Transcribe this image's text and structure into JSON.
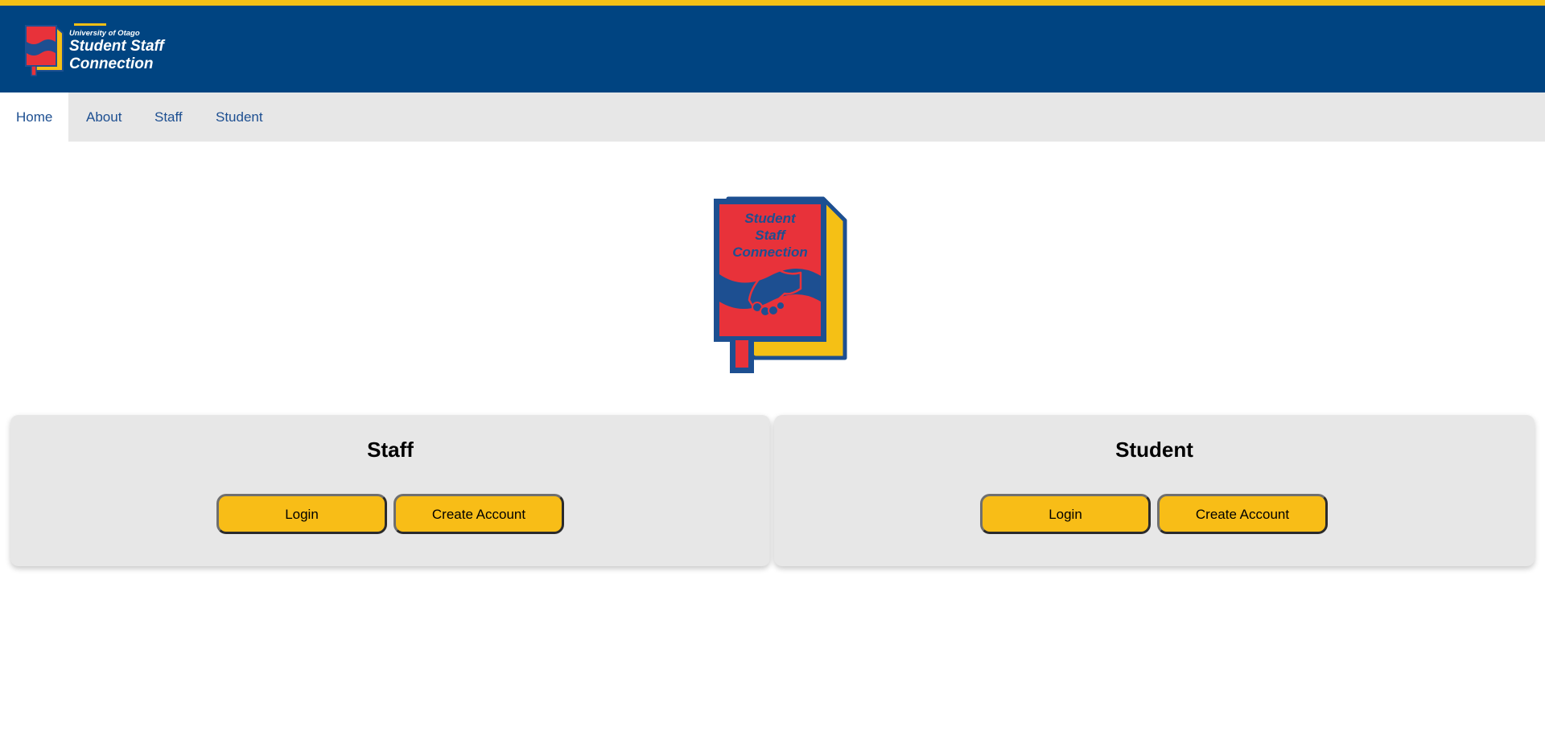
{
  "header": {
    "university": "University of Otago",
    "brand_line1": "Student Staff",
    "brand_line2": "Connection"
  },
  "nav": {
    "items": [
      {
        "label": "Home",
        "active": true
      },
      {
        "label": "About",
        "active": false
      },
      {
        "label": "Staff",
        "active": false
      },
      {
        "label": "Student",
        "active": false
      }
    ]
  },
  "hero": {
    "logo_line1": "Student",
    "logo_line2": "Staff",
    "logo_line3": "Connection"
  },
  "cards": [
    {
      "title": "Staff",
      "login_label": "Login",
      "create_label": "Create Account"
    },
    {
      "title": "Student",
      "login_label": "Login",
      "create_label": "Create Account"
    }
  ],
  "colors": {
    "header_blue": "#004481",
    "accent_yellow": "#f5c015",
    "logo_red": "#e8323a",
    "nav_text": "#1d4f91",
    "panel_gray": "#e7e7e7"
  },
  "icons": [
    "book-handshake-logo-icon"
  ]
}
